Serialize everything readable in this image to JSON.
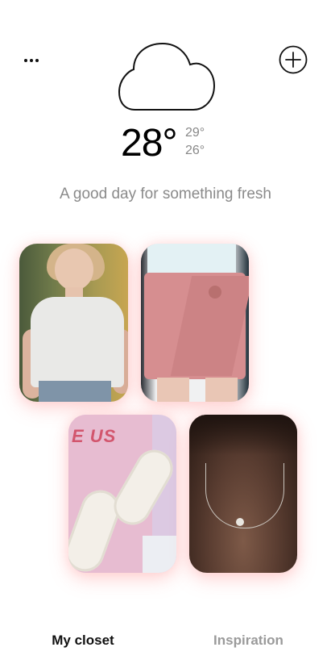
{
  "header": {
    "menu_icon": "more-horizontal-icon",
    "add_icon": "plus-circle-icon"
  },
  "weather": {
    "icon": "cloud-icon",
    "temperature": "28°",
    "high": "29°",
    "low": "26°",
    "tagline": "A good day for something fresh"
  },
  "outfit": {
    "items": [
      {
        "name": "white-tshirt"
      },
      {
        "name": "pink-shorts"
      },
      {
        "name": "white-sneakers"
      },
      {
        "name": "necklace"
      }
    ]
  },
  "nav": {
    "tabs": [
      {
        "label": "My closet",
        "active": true
      },
      {
        "label": "Inspiration",
        "active": false
      }
    ]
  },
  "colors": {
    "text_primary": "#111111",
    "text_muted": "#8a8a8a",
    "tile_glow": "#ff7878"
  }
}
